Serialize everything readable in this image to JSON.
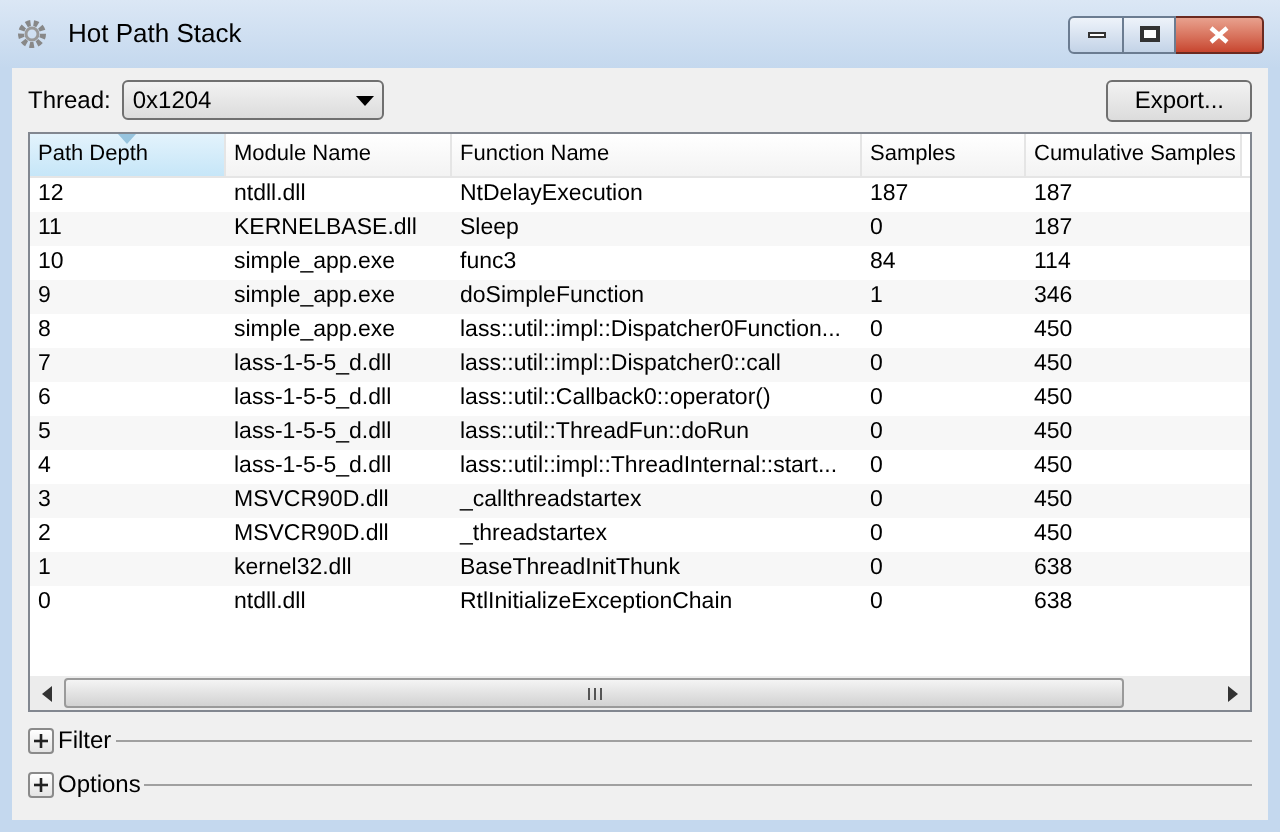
{
  "window": {
    "title": "Hot Path Stack"
  },
  "thread": {
    "label": "Thread:",
    "value": "0x1204"
  },
  "export_button": "Export...",
  "table": {
    "columns": [
      {
        "label": "Path Depth",
        "selected": true
      },
      {
        "label": "Module Name",
        "selected": false
      },
      {
        "label": "Function Name",
        "selected": false
      },
      {
        "label": "Samples",
        "selected": false
      },
      {
        "label": "Cumulative Samples",
        "selected": false
      }
    ],
    "rows": [
      [
        "12",
        "ntdll.dll",
        "NtDelayExecution",
        "187",
        "187"
      ],
      [
        "11",
        "KERNELBASE.dll",
        "Sleep",
        "0",
        "187"
      ],
      [
        "10",
        "simple_app.exe",
        "func3",
        "84",
        "114"
      ],
      [
        "9",
        "simple_app.exe",
        "doSimpleFunction",
        "1",
        "346"
      ],
      [
        "8",
        "simple_app.exe",
        "lass::util::impl::Dispatcher0Function...",
        "0",
        "450"
      ],
      [
        "7",
        "lass-1-5-5_d.dll",
        "lass::util::impl::Dispatcher0::call",
        "0",
        "450"
      ],
      [
        "6",
        "lass-1-5-5_d.dll",
        "lass::util::Callback0::operator()",
        "0",
        "450"
      ],
      [
        "5",
        "lass-1-5-5_d.dll",
        "lass::util::ThreadFun::doRun",
        "0",
        "450"
      ],
      [
        "4",
        "lass-1-5-5_d.dll",
        "lass::util::impl::ThreadInternal::start...",
        "0",
        "450"
      ],
      [
        "3",
        "MSVCR90D.dll",
        "_callthreadstartex",
        "0",
        "450"
      ],
      [
        "2",
        "MSVCR90D.dll",
        "_threadstartex",
        "0",
        "450"
      ],
      [
        "1",
        "kernel32.dll",
        "BaseThreadInitThunk",
        "0",
        "638"
      ],
      [
        "0",
        "ntdll.dll",
        "RtlInitializeExceptionChain",
        "0",
        "638"
      ]
    ]
  },
  "sections": [
    {
      "label": "Filter",
      "expanded": false
    },
    {
      "label": "Options",
      "expanded": false
    }
  ]
}
